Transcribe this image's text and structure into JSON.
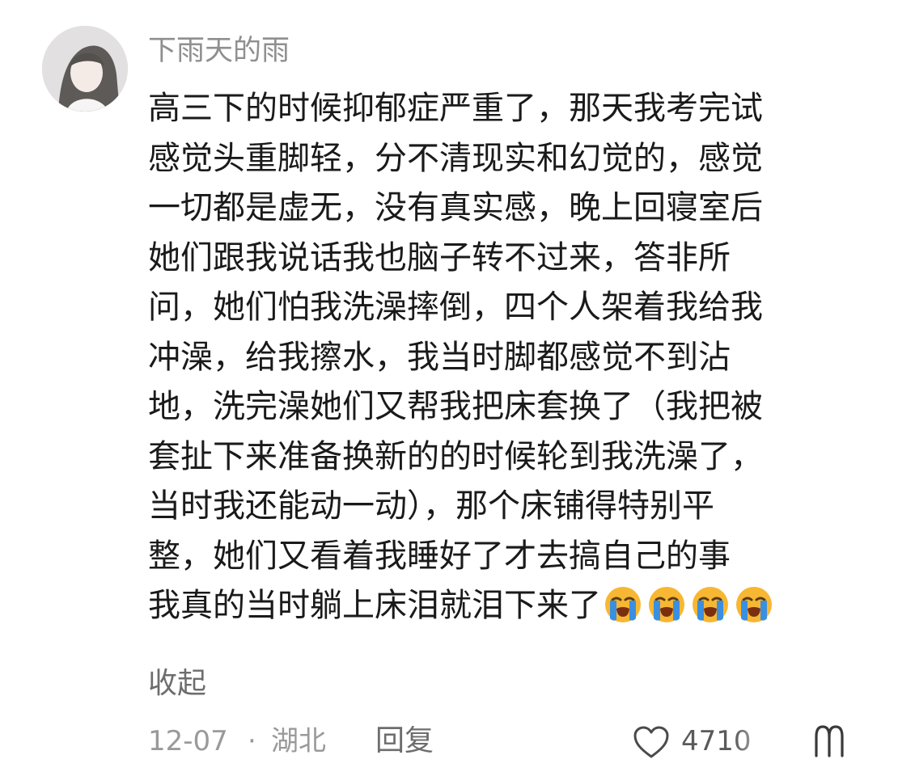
{
  "comment": {
    "username": "下雨天的雨",
    "body_lines": [
      "高三下的时候抑郁症严重了，那天我考完试",
      "感觉头重脚轻，分不清现实和幻觉的，感觉",
      "一切都是虚无，没有真实感，晚上回寝室后",
      "她们跟我说话我也脑子转不过来，答非所",
      "问，她们怕我洗澡摔倒，四个人架着我给我",
      "冲澡，给我擦水，我当时脚都感觉不到沾",
      "地，洗完澡她们又帮我把床套换了（我把被",
      "套扯下来准备换新的的时候轮到我洗澡了，",
      "当时我还能动一动），那个床铺得特别平",
      "整，她们又看着我睡好了才去搞自己的事",
      "我真的当时躺上床泪就泪下来了"
    ],
    "trailing_emoji": [
      "loudly-crying-face",
      "loudly-crying-face",
      "loudly-crying-face",
      "loudly-crying-face"
    ],
    "collapse_label": "收起",
    "date": "12-07",
    "separator": "·",
    "region": "湖北",
    "reply_label": "回复",
    "like_count": "4710",
    "colors": {
      "username": "#8f8f8f",
      "text": "#1a1a1a",
      "meta": "#9a9a9a",
      "emoji_face": "#f7b733",
      "emoji_tears": "#3b8fe0"
    }
  }
}
